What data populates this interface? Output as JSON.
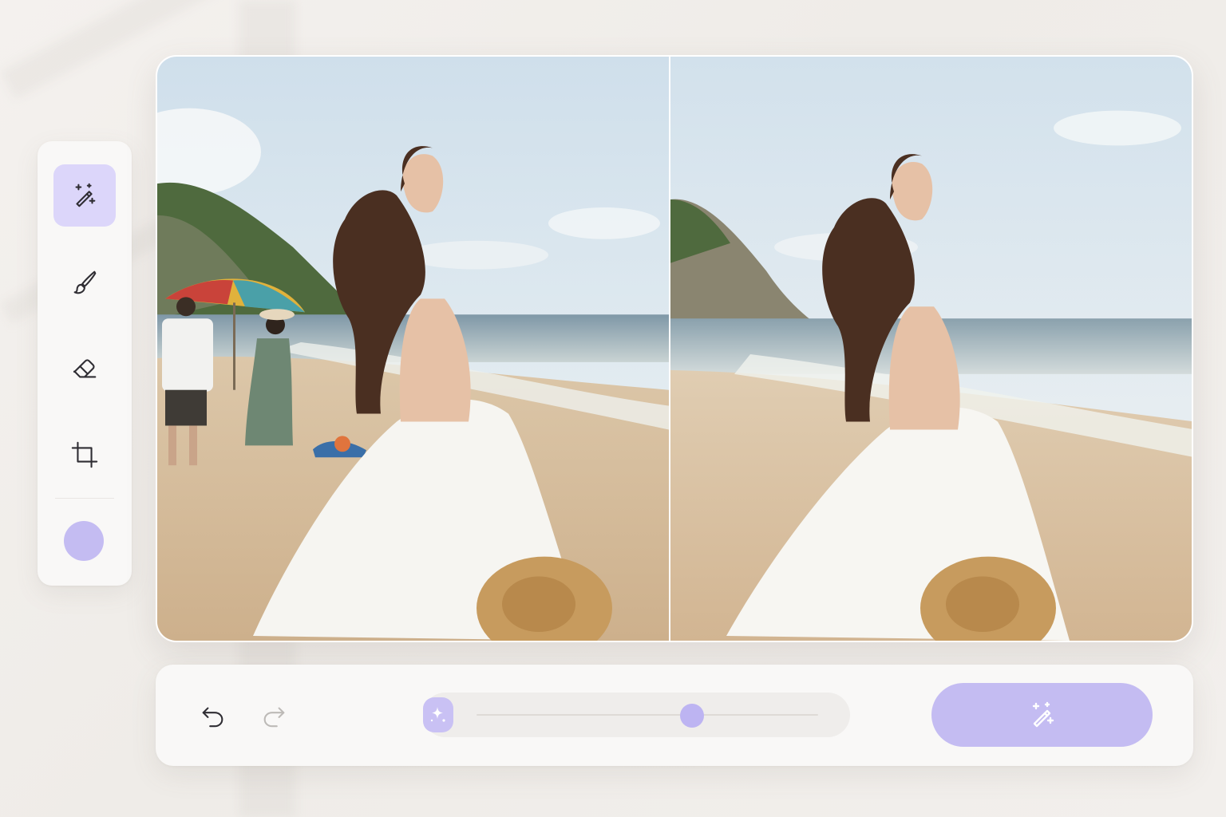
{
  "tools": [
    {
      "id": "magic",
      "icon": "magic-wand-icon",
      "active": true
    },
    {
      "id": "brush",
      "icon": "brush-icon",
      "active": false
    },
    {
      "id": "eraser",
      "icon": "eraser-icon",
      "active": false
    },
    {
      "id": "crop",
      "icon": "crop-icon",
      "active": false
    }
  ],
  "color_swatch": "#c4bcf2",
  "accent": "#c4bcf2",
  "accent_active_bg": "#dcd6fa",
  "canvas": {
    "before_image": "beach-photo-with-people",
    "after_image": "beach-photo-people-removed"
  },
  "toolbar": {
    "undo_icon": "undo-icon",
    "redo_icon": "redo-icon",
    "redo_enabled": false,
    "slider_icon": "sparkle-icon",
    "slider_value": 0.63,
    "apply_icon": "magic-wand-icon"
  }
}
